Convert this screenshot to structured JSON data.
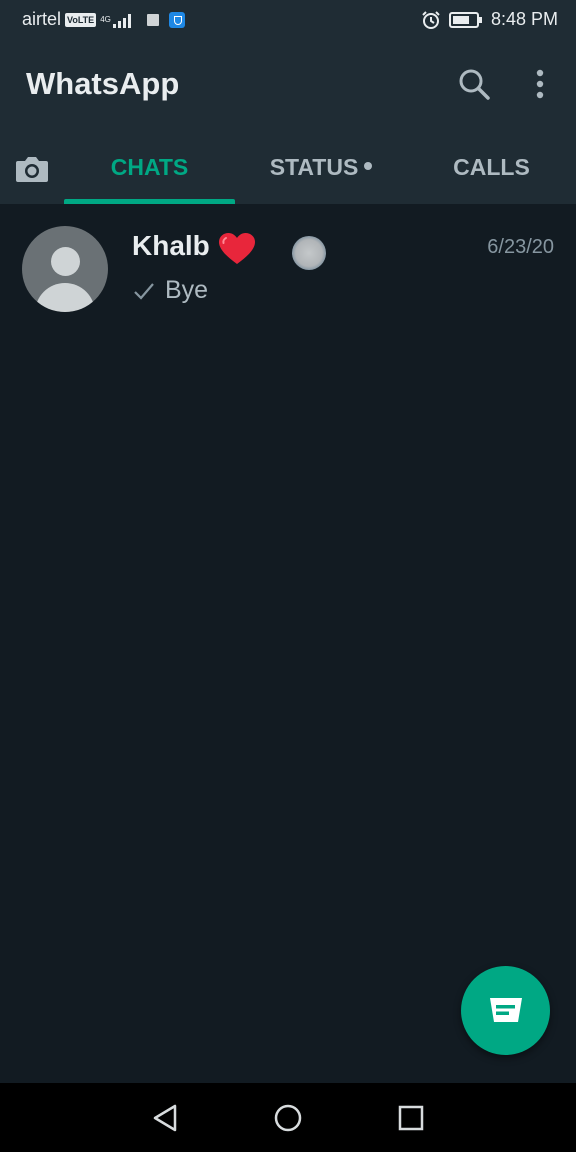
{
  "status_bar": {
    "carrier": "airtel",
    "volte": "VoLTE",
    "network": "4G",
    "time": "8:48 PM"
  },
  "app": {
    "title": "WhatsApp",
    "accent_color": "#00a884"
  },
  "tabs": [
    {
      "label": "",
      "icon": "camera-icon"
    },
    {
      "label": "CHATS",
      "active": true
    },
    {
      "label": "STATUS",
      "has_dot": true
    },
    {
      "label": "CALLS"
    }
  ],
  "chats": [
    {
      "name": "Khalb",
      "emoji": "heart-icon",
      "time": "6/23/20",
      "status_icon": "single-check-icon",
      "preview": "Bye"
    }
  ],
  "fab": {
    "icon": "new-chat-icon"
  },
  "nav_bar": {
    "icons": [
      "back-icon",
      "home-icon",
      "recents-icon"
    ]
  }
}
